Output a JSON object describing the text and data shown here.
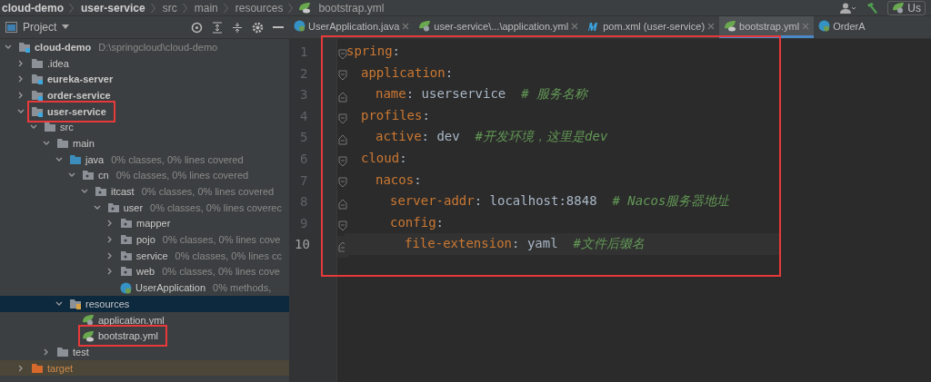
{
  "breadcrumb": [
    "cloud-demo",
    "user-service",
    "src",
    "main",
    "resources",
    "bootstrap.yml"
  ],
  "toolbar": {
    "user_button": "Us"
  },
  "project_panel": {
    "title": "Project",
    "tree": [
      {
        "label": "cloud-demo",
        "hint": "D:\\springcloud\\cloud-demo",
        "kind": "module",
        "expanded": true,
        "selected": false,
        "annotated": false,
        "children": [
          {
            "label": ".idea",
            "kind": "folder",
            "expanded": false,
            "selected": false,
            "annotated": false
          },
          {
            "label": "eureka-server",
            "kind": "module",
            "expanded": false,
            "selected": false,
            "annotated": false
          },
          {
            "label": "order-service",
            "kind": "module",
            "expanded": false,
            "selected": false,
            "annotated": false
          },
          {
            "label": "user-service",
            "kind": "module",
            "expanded": true,
            "selected": false,
            "annotated": true,
            "children": [
              {
                "label": "src",
                "kind": "folder",
                "expanded": true,
                "selected": false,
                "annotated": false,
                "children": [
                  {
                    "label": "main",
                    "kind": "folder",
                    "expanded": true,
                    "selected": false,
                    "annotated": false,
                    "children": [
                      {
                        "label": "java",
                        "hint": "0% classes, 0% lines covered",
                        "kind": "source",
                        "expanded": true,
                        "selected": false,
                        "annotated": false,
                        "children": [
                          {
                            "label": "cn",
                            "hint": "0% classes, 0% lines covered",
                            "kind": "package",
                            "expanded": true,
                            "selected": false,
                            "annotated": false,
                            "children": [
                              {
                                "label": "itcast",
                                "hint": "0% classes, 0% lines covered",
                                "kind": "package",
                                "expanded": true,
                                "selected": false,
                                "annotated": false,
                                "children": [
                                  {
                                    "label": "user",
                                    "hint": "0% classes, 0% lines coverec",
                                    "kind": "package",
                                    "expanded": true,
                                    "selected": false,
                                    "annotated": false,
                                    "children": [
                                      {
                                        "label": "mapper",
                                        "kind": "package",
                                        "expanded": false,
                                        "selected": false,
                                        "annotated": false
                                      },
                                      {
                                        "label": "pojo",
                                        "hint": "0% classes, 0% lines cove",
                                        "kind": "package",
                                        "expanded": false,
                                        "selected": false,
                                        "annotated": false
                                      },
                                      {
                                        "label": "service",
                                        "hint": "0% classes, 0% lines cc",
                                        "kind": "package",
                                        "expanded": false,
                                        "selected": false,
                                        "annotated": false
                                      },
                                      {
                                        "label": "web",
                                        "hint": "0% classes, 0% lines cove",
                                        "kind": "package",
                                        "expanded": false,
                                        "selected": false,
                                        "annotated": false
                                      },
                                      {
                                        "label": "UserApplication",
                                        "hint": "0% methods,",
                                        "kind": "class",
                                        "selected": false,
                                        "annotated": false
                                      }
                                    ]
                                  }
                                ]
                              }
                            ]
                          }
                        ]
                      },
                      {
                        "label": "resources",
                        "kind": "resources",
                        "expanded": true,
                        "selected": true,
                        "annotated": false,
                        "children": [
                          {
                            "label": "application.yml",
                            "kind": "spring-config",
                            "selected": false,
                            "annotated": false
                          },
                          {
                            "label": "bootstrap.yml",
                            "kind": "spring-cloud",
                            "selected": false,
                            "annotated": true
                          }
                        ]
                      }
                    ]
                  },
                  {
                    "label": "test",
                    "kind": "folder",
                    "expanded": false,
                    "selected": false,
                    "annotated": false
                  }
                ]
              }
            ]
          },
          {
            "label": "target",
            "kind": "excluded",
            "expanded": false,
            "selected": false,
            "annotated": false
          }
        ]
      }
    ]
  },
  "editor": {
    "tabs": [
      {
        "label": "UserApplication.java",
        "kind": "class",
        "selected": false
      },
      {
        "label": "user-service\\...\\application.yml",
        "kind": "spring-config",
        "selected": false
      },
      {
        "label": "pom.xml (user-service)",
        "kind": "maven",
        "selected": false
      },
      {
        "label": "bootstrap.yml",
        "kind": "spring-cloud",
        "selected": true
      },
      {
        "label": "OrderA",
        "kind": "class",
        "selected": false
      }
    ],
    "annotated": true,
    "lines": [
      {
        "number": "1",
        "key": "spring",
        "colon": ":",
        "current": false,
        "children": [
          {
            "number": "2",
            "key": "application",
            "colon": ":",
            "current": false,
            "children": [
              {
                "number": "3",
                "key": "name",
                "colon": ":",
                "value": "userservice",
                "comment": "# 服务名称",
                "current": false
              }
            ]
          },
          {
            "number": "4",
            "key": "profiles",
            "colon": ":",
            "current": false,
            "children": [
              {
                "number": "5",
                "key": "active",
                "colon": ":",
                "value": "dev",
                "comment": "#开发环境，这里是dev",
                "current": false
              }
            ]
          },
          {
            "number": "6",
            "key": "cloud",
            "colon": ":",
            "current": false,
            "children": [
              {
                "number": "7",
                "key": "nacos",
                "colon": ":",
                "current": false,
                "children": [
                  {
                    "number": "8",
                    "key": "server-addr",
                    "colon": ":",
                    "value": "localhost:8848",
                    "comment": "# Nacos服务器地址",
                    "current": false
                  },
                  {
                    "number": "9",
                    "key": "config",
                    "colon": ":",
                    "current": false,
                    "children": [
                      {
                        "number": "10",
                        "key": "file-extension",
                        "colon": ":",
                        "value": "yaml",
                        "comment": "#文件后缀名",
                        "current": true
                      }
                    ]
                  }
                ]
              }
            ]
          }
        ]
      }
    ]
  }
}
